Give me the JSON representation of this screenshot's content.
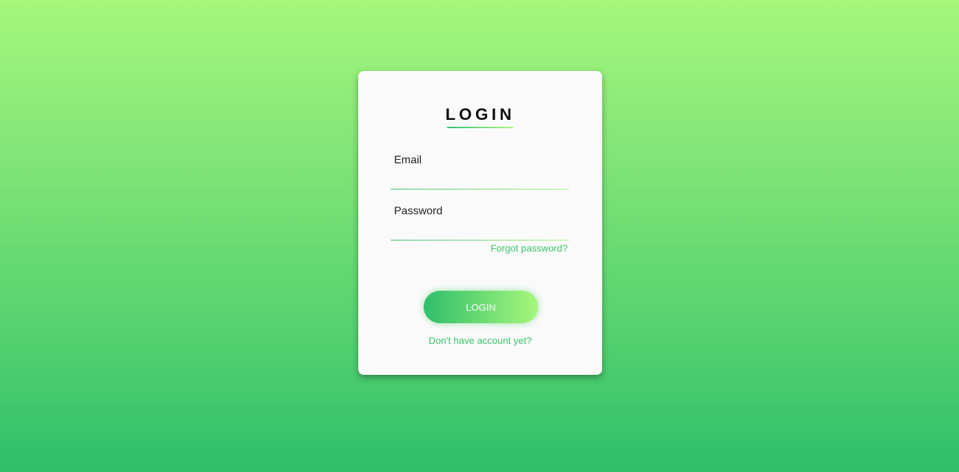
{
  "login_card": {
    "title": "LOGIN",
    "email": {
      "label": "Email",
      "value": ""
    },
    "password": {
      "label": "Password",
      "value": ""
    },
    "forgot_password_link": "Forgot password?",
    "submit_label": "LOGIN",
    "signup_link": "Don't have account yet?"
  },
  "colors": {
    "accent_start": "#2fbe6b",
    "accent_end": "#a6f77b",
    "link": "#3bc36c",
    "card_background": "#fafafa"
  }
}
